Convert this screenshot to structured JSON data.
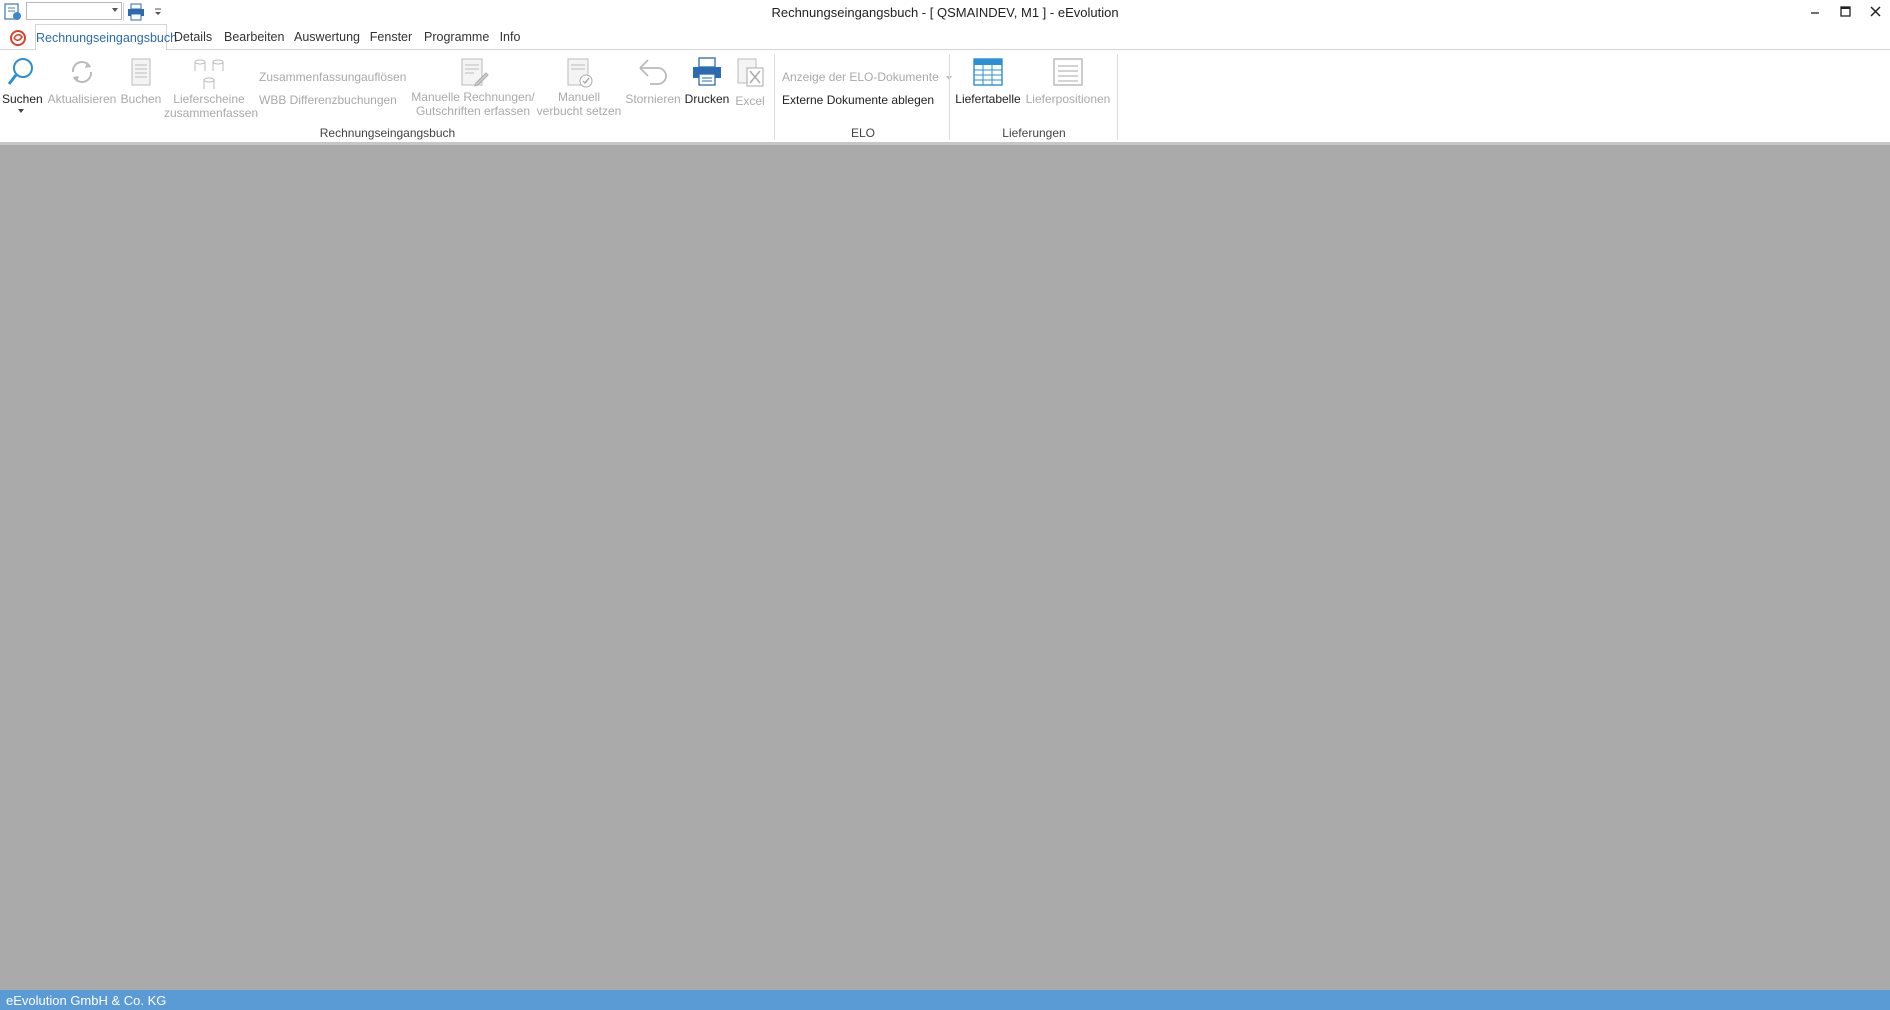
{
  "window": {
    "title": "Rechnungseingangsbuch - [ QSMAINDEV, M1 ]  -  eEvolution"
  },
  "qat": {
    "combo_value": ""
  },
  "tabs": [
    {
      "label": "Rechnungseingangsbuch",
      "active": true
    },
    {
      "label": "Details"
    },
    {
      "label": "Bearbeiten"
    },
    {
      "label": "Auswertung"
    },
    {
      "label": "Fenster"
    },
    {
      "label": "Programme"
    },
    {
      "label": "Info"
    }
  ],
  "ribbon": {
    "groups": {
      "rechnungseingangsbuch": {
        "label": "Rechnungseingangsbuch",
        "suchen": "Suchen",
        "aktualisieren": "Aktualisieren",
        "buchen": "Buchen",
        "lieferscheine_line1": "Lieferscheine",
        "lieferscheine_line2": "zusammenfassen",
        "zusammenfassung": "Zusammenfassung",
        "aufloesen": "auflösen",
        "wbb": "WBB Differenzbuchungen",
        "manuelle_line1": "Manuelle Rechnungen/",
        "manuelle_line2": "Gutschriften erfassen",
        "manuell_line1": "Manuell",
        "manuell_line2": "verbucht setzen",
        "stornieren": "Stornieren",
        "drucken": "Drucken",
        "excel": "Excel"
      },
      "elo": {
        "label": "ELO",
        "anzeige": "Anzeige der ELO-Dokumente",
        "externe": "Externe Dokumente ablegen"
      },
      "lieferungen": {
        "label": "Lieferungen",
        "liefertabelle": "Liefertabelle",
        "lieferpositionen": "Lieferpositionen"
      }
    }
  },
  "statusbar": {
    "text": "eEvolution GmbH & Co. KG"
  },
  "colors": {
    "accent": "#2b6bb2",
    "workspace": "#aaaaaa",
    "statusbar": "#5b9bd5",
    "disabled_text": "#a9a9a9"
  }
}
